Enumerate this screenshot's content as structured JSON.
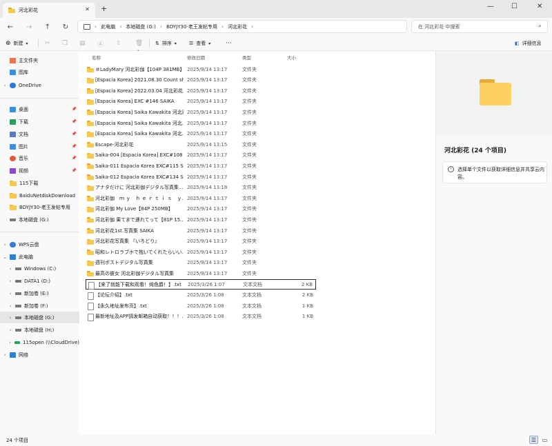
{
  "window": {
    "tab_title": "河北彩花",
    "new_tab": "+",
    "min": "—",
    "max": "☐",
    "close": "✕",
    "tab_close": "✕"
  },
  "nav": {
    "back": "←",
    "forward": "→",
    "up": "↑",
    "refresh": "↻",
    "more": "›"
  },
  "breadcrumb": [
    "此电脑",
    "本地磁盘 (G:)",
    "BDYJY30-老王发帖专用",
    "河北彩花"
  ],
  "search": {
    "placeholder": "在 河北彩花 中搜索",
    "icon": "search-icon"
  },
  "toolbar": {
    "new_label": "新建",
    "sort_label": "排序",
    "view_label": "查看",
    "more": "···",
    "details_label": "详细信息"
  },
  "columns": {
    "name": "名称",
    "date": "修改日期",
    "type": "类型",
    "size": "大小"
  },
  "sidebar": {
    "top": [
      {
        "label": "主文件夹"
      },
      {
        "label": "图库"
      },
      {
        "label": "OneDrive"
      }
    ],
    "quick": [
      {
        "label": "桌面",
        "color": "#3a8ee6"
      },
      {
        "label": "下载",
        "color": "#2aa05a"
      },
      {
        "label": "文档",
        "color": "#5a7ac8"
      },
      {
        "label": "图片",
        "color": "#3a8ee6"
      },
      {
        "label": "音乐",
        "color": "#e05a3a"
      },
      {
        "label": "视频",
        "color": "#8a4ad0"
      },
      {
        "label": "115下载",
        "color": "#f8c94d"
      },
      {
        "label": "BaiduNetdiskDownload",
        "color": "#f8c94d"
      },
      {
        "label": "BDYJY30-老王发帖专用",
        "color": "#f8c94d"
      },
      {
        "label": "本地磁盘 (G:)",
        "color": "#777777"
      }
    ],
    "tree": [
      {
        "label": "WPS云盘"
      },
      {
        "label": "此电脑"
      },
      {
        "label": "Windows (C:)"
      },
      {
        "label": "DATA1 (D:)"
      },
      {
        "label": "新加卷 (E:)"
      },
      {
        "label": "新加卷 (F:)"
      },
      {
        "label": "本地磁盘 (G:)"
      },
      {
        "label": "本地磁盘 (H:)"
      },
      {
        "label": "115open (\\\\CloudDrive)"
      },
      {
        "label": "网络"
      }
    ]
  },
  "files": [
    {
      "name": "＃LadyMary 河北彩伽【104P 381MB】",
      "date": "2025/9/14 13:17",
      "type": "文件夹",
      "size": ""
    },
    {
      "name": "[Espacia Korea] 2021.08.30 Count sh...",
      "date": "2025/9/14 13:17",
      "type": "文件夹",
      "size": ""
    },
    {
      "name": "[Espacia Korea] 2022.03.04 河北彩花...",
      "date": "2025/9/14 13:17",
      "type": "文件夹",
      "size": ""
    },
    {
      "name": "[Espacia Korea] EXC #146 SAIKA",
      "date": "2025/9/14 13:17",
      "type": "文件夹",
      "size": ""
    },
    {
      "name": "[Espacia Korea] Saika Kawakita 河北彩...",
      "date": "2025/9/14 13:17",
      "type": "文件夹",
      "size": ""
    },
    {
      "name": "[Espacia Korea] Saika Kawakita 河北...",
      "date": "2025/9/14 13:17",
      "type": "文件夹",
      "size": ""
    },
    {
      "name": "[Espacia Korea] Saika Kawakita 河北...",
      "date": "2025/9/14 13:17",
      "type": "文件夹",
      "size": ""
    },
    {
      "name": "Escape-河北彩花",
      "date": "2025/9/14 13:15",
      "type": "文件夹",
      "size": ""
    },
    {
      "name": "Saika-004 [Espacia Korea] EXC#108 (...",
      "date": "2025/9/14 13:17",
      "type": "文件夹",
      "size": ""
    },
    {
      "name": "Saika-011 Espacia Korea EXC#115 S...",
      "date": "2025/9/14 13:17",
      "type": "文件夹",
      "size": ""
    },
    {
      "name": "Saika-012 Espacia Korea EXC#134 S...",
      "date": "2025/9/14 13:17",
      "type": "文件夹",
      "size": ""
    },
    {
      "name": "アナタだけに 河北彩伽デジタル写真集...",
      "date": "2025/9/14 13:18",
      "type": "文件夹",
      "size": ""
    },
    {
      "name": "河北彩伽　ｍ ｙ　ｈ ｅ ｒ ｔ ｉ ｓ　ｙ...",
      "date": "2025/9/14 13:17",
      "type": "文件夹",
      "size": ""
    },
    {
      "name": "河北彩伽 My Love【84P 250MB】",
      "date": "2025/9/14 13:17",
      "type": "文件夹",
      "size": ""
    },
    {
      "name": "河北彩伽 果てまで連れてって【81P 15...",
      "date": "2025/9/14 13:17",
      "type": "文件夹",
      "size": ""
    },
    {
      "name": "河北彩花1st.写真集 SAIKA",
      "date": "2025/9/14 13:17",
      "type": "文件夹",
      "size": ""
    },
    {
      "name": "河北彩花写真集 『いろどり』",
      "date": "2025/9/14 13:17",
      "type": "文件夹",
      "size": ""
    },
    {
      "name": "昭和レトロラブホで抱いてくれたらいい...",
      "date": "2025/9/14 13:17",
      "type": "文件夹",
      "size": ""
    },
    {
      "name": "週刊ポストデジタル写真集",
      "date": "2025/9/14 13:17",
      "type": "文件夹",
      "size": ""
    },
    {
      "name": "最高の彼女 河北彩伽デジタル写真集",
      "date": "2025/9/14 13:17",
      "type": "文件夹",
      "size": ""
    },
    {
      "name": "【来了就能下载和观看！纯色爵！】.txt",
      "date": "2025/3/26 1:07",
      "type": "文本文档",
      "size": "2 KB",
      "selected": true
    },
    {
      "name": "【论坛介绍】.txt",
      "date": "2025/3/26 1:08",
      "type": "文本文档",
      "size": "2 KB"
    },
    {
      "name": "【永久地址发布页】.txt",
      "date": "2025/3/26 1:08",
      "type": "文本文档",
      "size": "1 KB"
    },
    {
      "name": "最新地址及APP請发邮箱自动获取！！！...",
      "date": "2025/3/26 1:08",
      "type": "文本文档",
      "size": "1 KB"
    }
  ],
  "details": {
    "title": "河北彩花 (24 个项目)",
    "info": "选择单个文件以获取详细信息并共享云内容。"
  },
  "status": {
    "count": "24 个项目"
  }
}
